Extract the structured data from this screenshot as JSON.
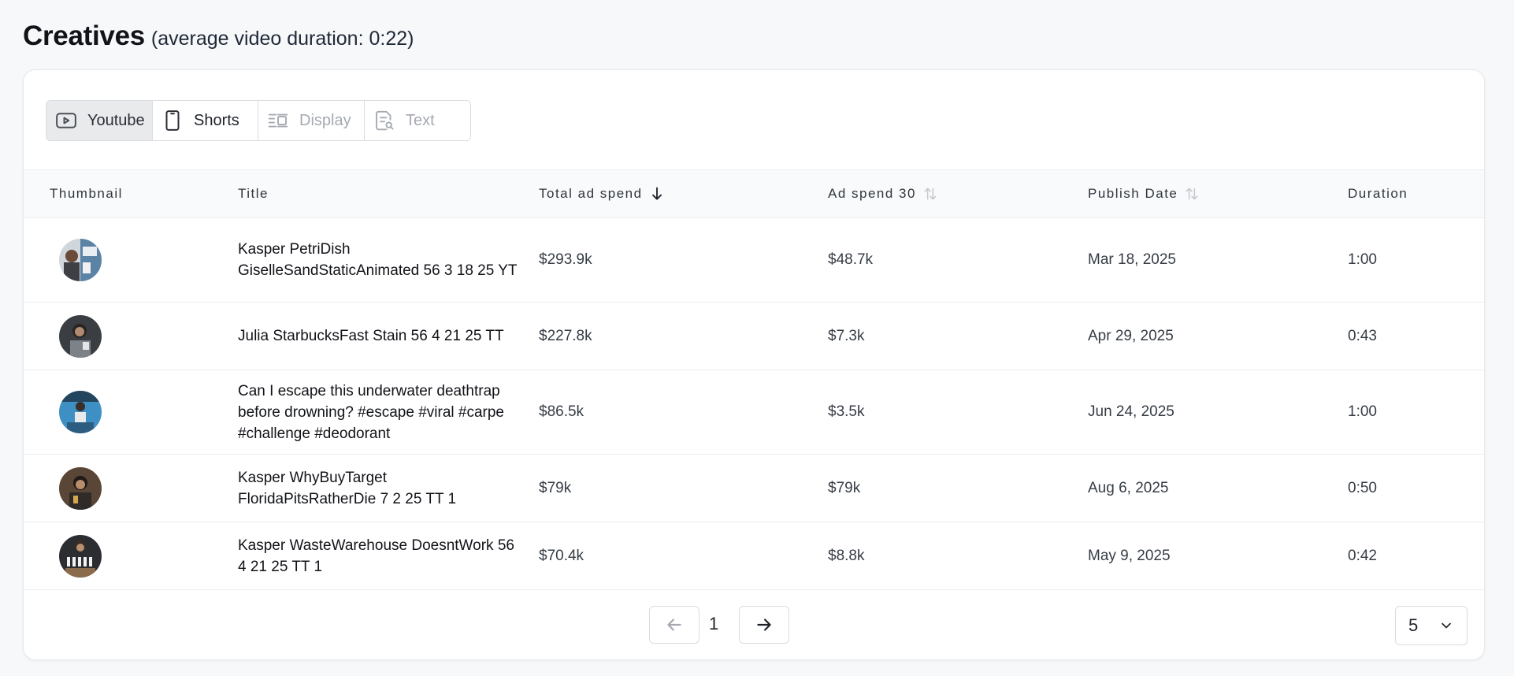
{
  "header": {
    "title": "Creatives",
    "subtitle": "(average video duration: 0:22)"
  },
  "tabs": [
    {
      "label": "Youtube",
      "icon": "play-square-icon",
      "state": "active"
    },
    {
      "label": "Shorts",
      "icon": "phone-icon",
      "state": "normal"
    },
    {
      "label": "Display",
      "icon": "display-layout-icon",
      "state": "disabled"
    },
    {
      "label": "Text",
      "icon": "text-search-icon",
      "state": "disabled"
    }
  ],
  "table": {
    "columns": {
      "thumbnail": "Thumbnail",
      "title": "Title",
      "total_ad_spend": "Total ad spend",
      "ad_spend_30": "Ad spend 30",
      "publish_date": "Publish Date",
      "duration": "Duration"
    },
    "sort": {
      "total_ad_spend": "desc",
      "ad_spend_30": "none",
      "publish_date": "none"
    },
    "rows": [
      {
        "title": "Kasper PetriDish GiselleSandStaticAnimated 56 3 18 25 YT",
        "total": "$293.9k",
        "ad30": "$48.7k",
        "date": "Mar 18, 2025",
        "duration": "1:00"
      },
      {
        "title": "Julia StarbucksFast Stain 56 4 21 25 TT",
        "total": "$227.8k",
        "ad30": "$7.3k",
        "date": "Apr 29, 2025",
        "duration": "0:43"
      },
      {
        "title": "Can I escape this underwater deathtrap before drowning? #escape #viral #carpe #challenge #deodorant",
        "total": "$86.5k",
        "ad30": "$3.5k",
        "date": "Jun 24, 2025",
        "duration": "1:00"
      },
      {
        "title": "Kasper WhyBuyTarget FloridaPitsRatherDie 7 2 25 TT 1",
        "total": "$79k",
        "ad30": "$79k",
        "date": "Aug 6, 2025",
        "duration": "0:50"
      },
      {
        "title": "Kasper WasteWarehouse DoesntWork 56 4 21 25 TT 1",
        "total": "$70.4k",
        "ad30": "$8.8k",
        "date": "May 9, 2025",
        "duration": "0:42"
      }
    ]
  },
  "pagination": {
    "current_page": "1",
    "page_size": "5"
  },
  "colors": {
    "accent_active_tab": "#e9eaec",
    "border": "#d9dce1",
    "text_primary": "#111318",
    "text_muted": "#a4a9b1"
  }
}
